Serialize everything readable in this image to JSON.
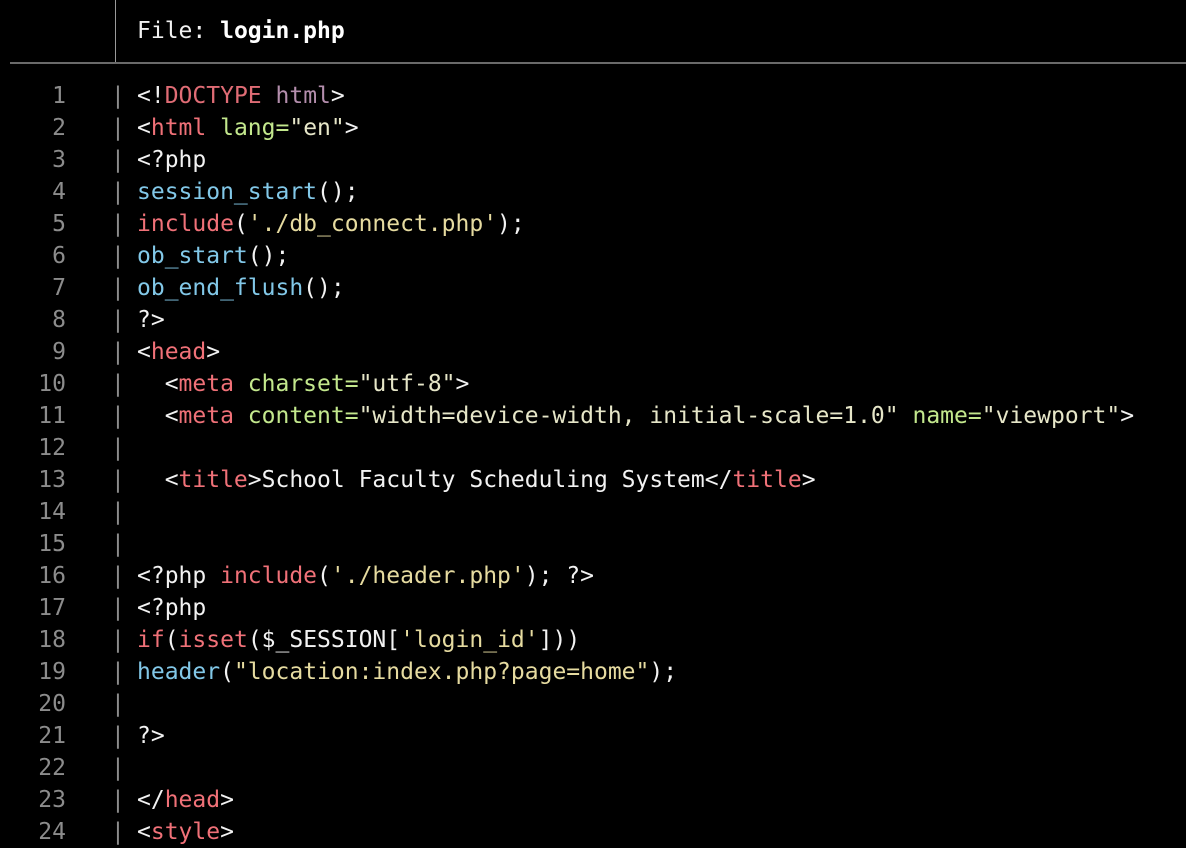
{
  "header": {
    "prefix": "File: ",
    "filename": "login.php"
  },
  "lines": [
    {
      "no": "1",
      "tokens": [
        [
          "<!",
          "plain"
        ],
        [
          "DOCTYPE",
          "doctype"
        ],
        [
          " ",
          "plain"
        ],
        [
          "html",
          "kw-purple"
        ],
        [
          ">",
          "plain"
        ]
      ]
    },
    {
      "no": "2",
      "tokens": [
        [
          "<",
          "plain"
        ],
        [
          "html",
          "tag"
        ],
        [
          " ",
          "plain"
        ],
        [
          "lang=",
          "attr"
        ],
        [
          "\"en\"",
          "str"
        ],
        [
          ">",
          "plain"
        ]
      ]
    },
    {
      "no": "3",
      "tokens": [
        [
          "<?php",
          "plain"
        ]
      ]
    },
    {
      "no": "4",
      "tokens": [
        [
          "session_start",
          "fn"
        ],
        [
          "();",
          "plain"
        ]
      ]
    },
    {
      "no": "5",
      "tokens": [
        [
          "include",
          "builtin"
        ],
        [
          "(",
          "plain"
        ],
        [
          "'./db_connect.php'",
          "pstr"
        ],
        [
          ");",
          "plain"
        ]
      ]
    },
    {
      "no": "6",
      "tokens": [
        [
          "ob_start",
          "fn"
        ],
        [
          "();",
          "plain"
        ]
      ]
    },
    {
      "no": "7",
      "tokens": [
        [
          "ob_end_flush",
          "fn"
        ],
        [
          "();",
          "plain"
        ]
      ]
    },
    {
      "no": "8",
      "tokens": [
        [
          "?>",
          "plain"
        ]
      ]
    },
    {
      "no": "9",
      "tokens": [
        [
          "<",
          "plain"
        ],
        [
          "head",
          "tag"
        ],
        [
          ">",
          "plain"
        ]
      ]
    },
    {
      "no": "10",
      "tokens": [
        [
          "  <",
          "plain"
        ],
        [
          "meta",
          "tag"
        ],
        [
          " ",
          "plain"
        ],
        [
          "charset=",
          "attr"
        ],
        [
          "\"utf-8\"",
          "str"
        ],
        [
          ">",
          "plain"
        ]
      ]
    },
    {
      "no": "11",
      "tokens": [
        [
          "  <",
          "plain"
        ],
        [
          "meta",
          "tag"
        ],
        [
          " ",
          "plain"
        ],
        [
          "content=",
          "attr"
        ],
        [
          "\"width=device-width, initial-scale=1.0\"",
          "str"
        ],
        [
          " ",
          "plain"
        ],
        [
          "name=",
          "attr"
        ],
        [
          "\"viewport\"",
          "str"
        ],
        [
          ">",
          "plain"
        ]
      ]
    },
    {
      "no": "12",
      "tokens": []
    },
    {
      "no": "13",
      "tokens": [
        [
          "  <",
          "plain"
        ],
        [
          "title",
          "tag"
        ],
        [
          ">School Faculty Scheduling System</",
          "plain"
        ],
        [
          "title",
          "tag"
        ],
        [
          ">",
          "plain"
        ]
      ]
    },
    {
      "no": "14",
      "tokens": []
    },
    {
      "no": "15",
      "tokens": []
    },
    {
      "no": "16",
      "tokens": [
        [
          "<?php ",
          "plain"
        ],
        [
          "include",
          "builtin"
        ],
        [
          "(",
          "plain"
        ],
        [
          "'./header.php'",
          "pstr"
        ],
        [
          "); ?>",
          "plain"
        ]
      ]
    },
    {
      "no": "17",
      "tokens": [
        [
          "<?php",
          "plain"
        ]
      ]
    },
    {
      "no": "18",
      "tokens": [
        [
          "if",
          "builtin"
        ],
        [
          "(",
          "plain"
        ],
        [
          "isset",
          "builtin"
        ],
        [
          "($_SESSION[",
          "plain"
        ],
        [
          "'login_id'",
          "pstr"
        ],
        [
          "]))",
          "plain"
        ]
      ]
    },
    {
      "no": "19",
      "tokens": [
        [
          "header",
          "fn"
        ],
        [
          "(",
          "plain"
        ],
        [
          "\"location:index.php?page=home\"",
          "pstr"
        ],
        [
          ");",
          "plain"
        ]
      ]
    },
    {
      "no": "20",
      "tokens": []
    },
    {
      "no": "21",
      "tokens": [
        [
          "?>",
          "plain"
        ]
      ]
    },
    {
      "no": "22",
      "tokens": []
    },
    {
      "no": "23",
      "tokens": [
        [
          "</",
          "plain"
        ],
        [
          "head",
          "tag"
        ],
        [
          ">",
          "plain"
        ]
      ]
    },
    {
      "no": "24",
      "tokens": [
        [
          "<",
          "plain"
        ],
        [
          "style",
          "tag"
        ],
        [
          ">",
          "plain"
        ]
      ]
    }
  ]
}
